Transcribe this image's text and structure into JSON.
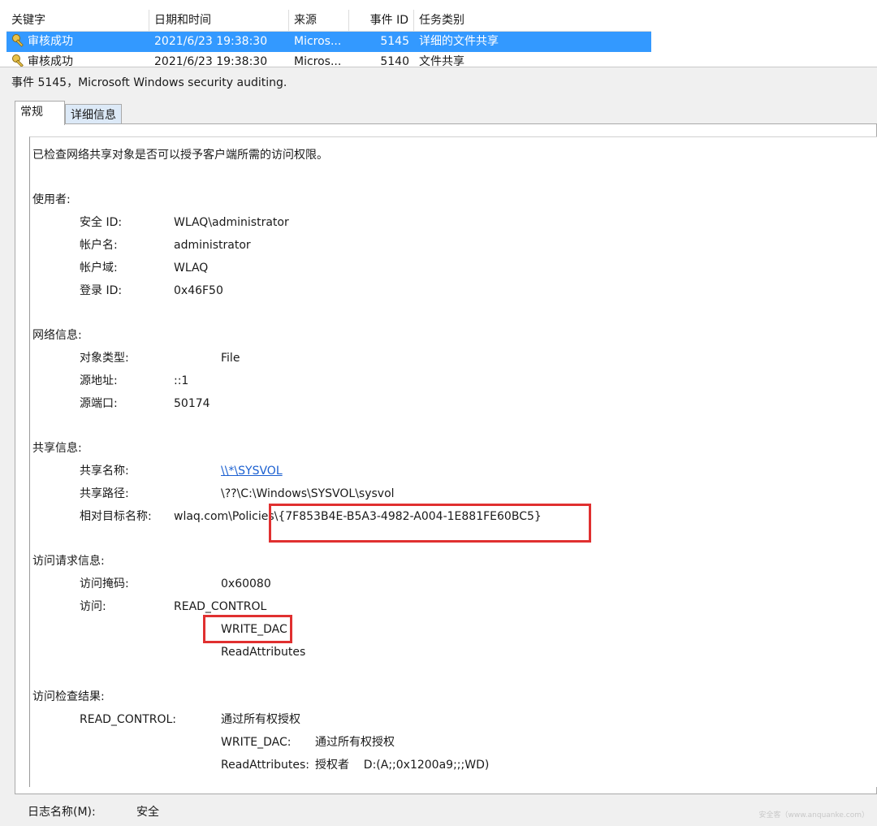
{
  "list": {
    "columns": [
      "关键字",
      "日期和时间",
      "来源",
      "事件 ID",
      "任务类别"
    ],
    "rows": [
      {
        "keyword": "审核成功",
        "datetime": "2021/6/23 19:38:30",
        "source": "Micros...",
        "event_id": "5145",
        "category": "详细的文件共享",
        "selected": true
      },
      {
        "keyword": "审核成功",
        "datetime": "2021/6/23 19:38:30",
        "source": "Micros...",
        "event_id": "5140",
        "category": "文件共享",
        "selected": false
      }
    ]
  },
  "detail": {
    "title": "事件 5145，Microsoft Windows security auditing.",
    "tabs": [
      "常规",
      "详细信息"
    ],
    "summary": "已检查网络共享对象是否可以授予客户端所需的访问权限。",
    "subject": {
      "heading": "使用者:",
      "fields": [
        {
          "label": "安全 ID:",
          "value": "WLAQ\\administrator"
        },
        {
          "label": "帐户名:",
          "value": "administrator"
        },
        {
          "label": "帐户域:",
          "value": "WLAQ"
        },
        {
          "label": "登录 ID:",
          "value": "0x46F50"
        }
      ]
    },
    "network": {
      "heading": "网络信息:",
      "fields": [
        {
          "label": "对象类型:",
          "value": "File"
        },
        {
          "label": "源地址:",
          "value": "::1"
        },
        {
          "label": "源端口:",
          "value": "50174"
        }
      ]
    },
    "share": {
      "heading": "共享信息:",
      "fields": [
        {
          "label": "共享名称:",
          "value": "\\\\*\\SYSVOL"
        },
        {
          "label": "共享路径:",
          "value": "\\??\\C:\\Windows\\SYSVOL\\sysvol"
        },
        {
          "label": "相对目标名称:",
          "value": "wlaq.com\\Policies\\{7F853B4E-B5A3-4982-A004-1E881FE60BC5}"
        }
      ]
    },
    "access_request": {
      "heading": "访问请求信息:",
      "mask_label": "访问掩码:",
      "mask_value": "0x60080",
      "access_label": "访问:",
      "access_values": [
        "READ_CONTROL",
        "WRITE_DAC",
        "ReadAttributes"
      ]
    },
    "access_check": {
      "heading": "访问检查结果:",
      "rows": [
        {
          "label": "READ_CONTROL:",
          "value": "通过所有权授权"
        },
        {
          "label": "WRITE_DAC:",
          "value": "通过所有权授权"
        },
        {
          "label": "ReadAttributes:",
          "value": "授权者    D:(A;;0x1200a9;;;WD)"
        }
      ]
    },
    "log_name_label": "日志名称(M):",
    "log_name_value": "安全"
  },
  "colors": {
    "selection": "#3399ff",
    "highlight_box": "#e03030",
    "link": "#1a5fd0"
  },
  "watermark": "安全客（www.anquanke.com）"
}
